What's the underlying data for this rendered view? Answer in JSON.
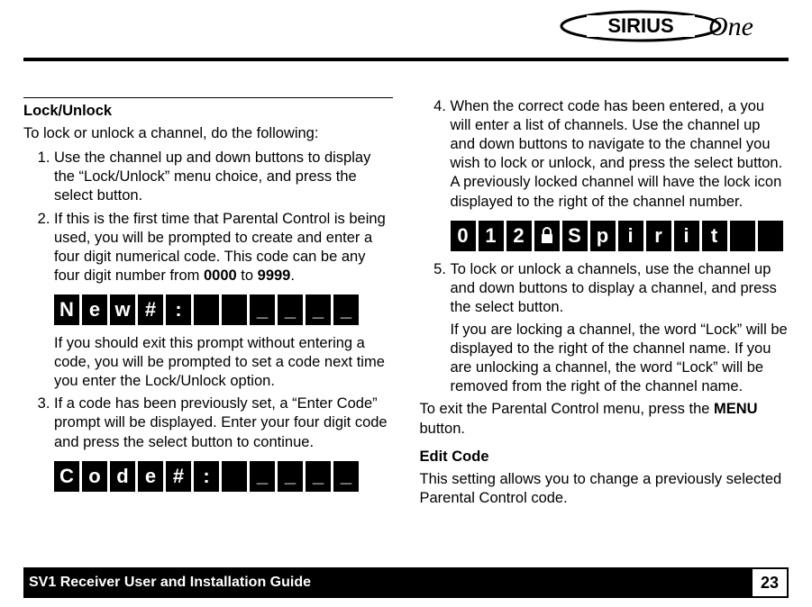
{
  "brand": {
    "name": "SIRIUS One"
  },
  "footer": {
    "title": "SV1 Receiver User and Installation Guide",
    "page": "23"
  },
  "left": {
    "heading": "Lock/Unlock",
    "intro": "To lock or unlock a channel, do the following:",
    "step1": "Use the channel up and down buttons to display the “Lock/Unlock” menu choice, and press the select button.",
    "step2a": "If this is the first time that Parental Control is being used, you will be prompted to create and enter a four digit numerical code. This code can be any four digit number from ",
    "step2b": "0000",
    "step2c": " to ",
    "step2d": "9999",
    "step2e": ".",
    "lcd1": [
      "N",
      "e",
      "w",
      "#",
      ":",
      "",
      "",
      "_",
      "_",
      "_",
      "_"
    ],
    "note1": "If you should exit this prompt without entering a code, you will be prompted to set a code next time you enter the Lock/Unlock option.",
    "step3": "If a code has been previously set, a “Enter Code” prompt will be displayed. Enter your four digit code and press the select button to continue.",
    "lcd2": [
      "C",
      "o",
      "d",
      "e",
      "#",
      ":",
      "",
      "_",
      "_",
      "_",
      "_"
    ]
  },
  "right": {
    "step4": "When the correct code has been entered, a you will enter a list of channels. Use the channel up and down buttons to navigate to the channel you wish to lock or unlock, and press the select button. A previously locked channel will have the lock icon displayed to the right of the channel number.",
    "lcd3": [
      "0",
      "1",
      "2",
      "LOCK",
      "S",
      "p",
      "i",
      "r",
      "i",
      "t",
      "",
      ""
    ],
    "step5a": "To lock or unlock a channels, use the channel up and down buttons to display a channel, and press the select button.",
    "step5b": "If you are locking a channel, the word “Lock” will be displayed to the right of the channel name. If you are unlocking a channel, the word “Lock” will be removed from the right of the channel name.",
    "exit_a": "To exit the Parental Control menu, press the ",
    "exit_b": "MENU",
    "exit_c": " button.",
    "edit_heading": "Edit Code",
    "edit_body": "This setting allows you to change a previously selected Parental Control code."
  }
}
